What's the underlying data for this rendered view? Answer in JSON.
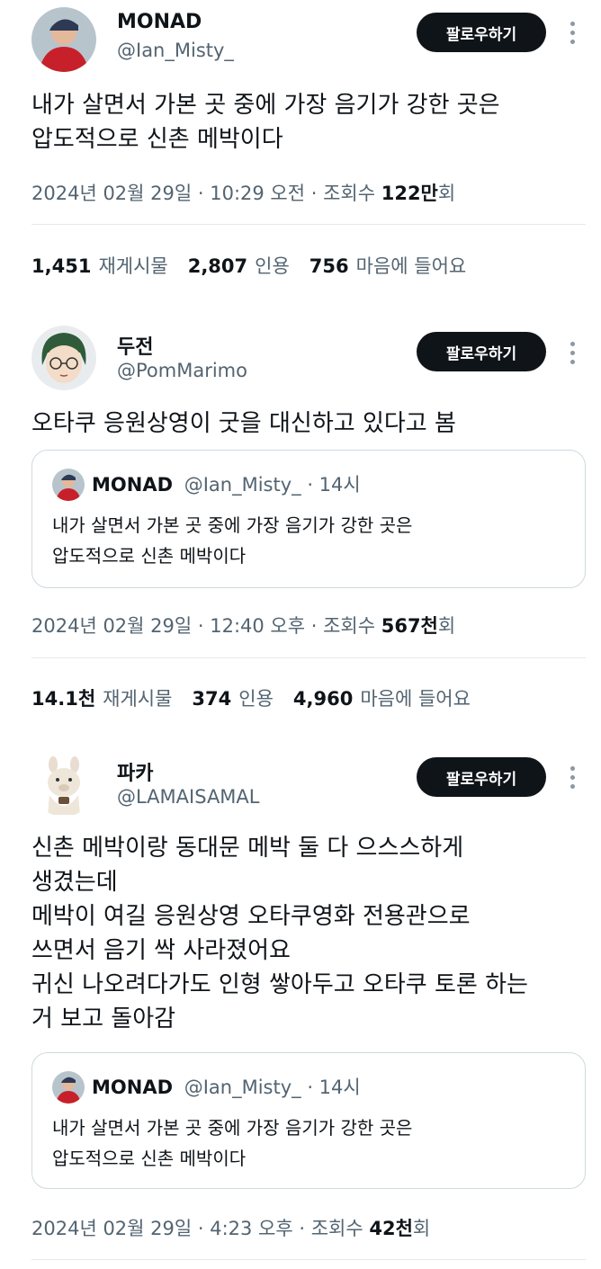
{
  "tweets": [
    {
      "name": "MONAD",
      "handle": "@Ian_Misty_",
      "follow_label": "팔로우하기",
      "text": "내가 살면서 가본 곳 중에 가장 음기가 강한 곳은\n압도적으로 신촌 메박이다",
      "timestamp": "2024년 02월 29일 · 10:29 오전 · 조회수 ",
      "views": "122만",
      "views_suffix": "회",
      "stats": {
        "reposts": "1,451",
        "reposts_label": "재게시물",
        "quotes": "2,807",
        "quotes_label": "인용",
        "likes": "756",
        "likes_label": "마음에 들어요"
      }
    },
    {
      "name": "두전",
      "handle": "@PomMarimo",
      "follow_label": "팔로우하기",
      "text": "오타쿠 응원상영이 굿을 대신하고 있다고 봄",
      "quote": {
        "name": "MONAD",
        "handle": "@Ian_Misty_",
        "time": "· 14시",
        "text": "내가 살면서 가본 곳 중에 가장 음기가 강한 곳은\n압도적으로 신촌 메박이다"
      },
      "timestamp": "2024년 02월 29일 · 12:40 오후 · 조회수 ",
      "views": "567천",
      "views_suffix": "회",
      "stats": {
        "reposts": "14.1천",
        "reposts_label": "재게시물",
        "quotes": "374",
        "quotes_label": "인용",
        "likes": "4,960",
        "likes_label": "마음에 들어요"
      }
    },
    {
      "name": "파카",
      "handle": "@LAMAISAMAL",
      "follow_label": "팔로우하기",
      "text": "신촌 메박이랑 동대문 메박 둘 다 으스스하게\n생겼는데\n메박이 여길 응원상영 오타쿠영화 전용관으로\n쓰면서 음기 싹 사라졌어요\n귀신 나오려다가도 인형 쌓아두고 오타쿠 토론 하는\n거 보고 돌아감",
      "quote": {
        "name": "MONAD",
        "handle": "@Ian_Misty_",
        "time": "· 14시",
        "text": "내가 살면서 가본 곳 중에 가장 음기가 강한 곳은\n압도적으로 신촌 메박이다"
      },
      "timestamp": "2024년 02월 29일 · 4:23 오후 · 조회수 ",
      "views": "42천",
      "views_suffix": "회"
    }
  ],
  "colors": {
    "button_bg": "#0f1419",
    "secondary_text": "#536471",
    "border": "#cfd9de"
  }
}
